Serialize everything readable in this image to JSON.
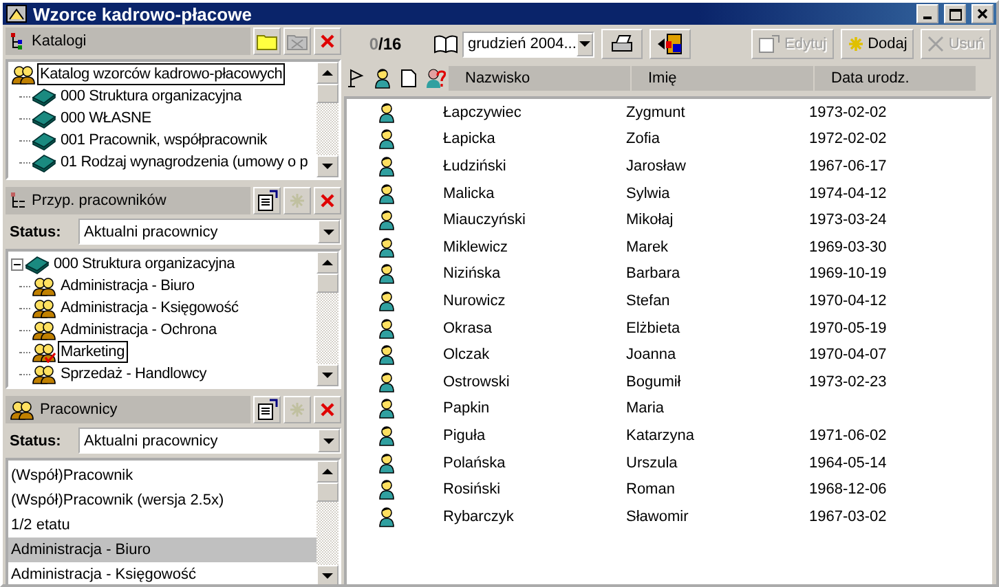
{
  "window": {
    "title": "Wzorce kadrowo-płacowe"
  },
  "katalogi": {
    "title": "Katalogi",
    "tree": [
      {
        "label": "Katalog wzorców kadrowo-płacowych",
        "kind": "group",
        "selected": true,
        "children": [
          {
            "label": "000 Struktura organizacyjna",
            "kind": "book",
            "selected": false
          },
          {
            "label": "000 WŁASNE",
            "kind": "book",
            "selected": false
          },
          {
            "label": "001 Pracownik, współpracownik",
            "kind": "book",
            "selected": false
          },
          {
            "label": "01 Rodzaj wynagrodzenia (umowy o p",
            "kind": "book",
            "selected": false
          }
        ]
      }
    ]
  },
  "przypisania": {
    "title": "Przyp. pracowników",
    "status_label": "Status:",
    "status_value": "Aktualni pracownicy",
    "tree": [
      {
        "label": "000 Struktura organizacyjna",
        "kind": "book",
        "selected": false,
        "expanded": true,
        "children": [
          {
            "label": "Administracja - Biuro",
            "kind": "group",
            "selected": false,
            "checked": false
          },
          {
            "label": "Administracja - Księgowość",
            "kind": "group",
            "selected": false,
            "checked": false
          },
          {
            "label": "Administracja - Ochrona",
            "kind": "group",
            "selected": false,
            "checked": false
          },
          {
            "label": "Marketing",
            "kind": "group",
            "selected": true,
            "checked": true
          },
          {
            "label": "Sprzedaż - Handlowcy",
            "kind": "group",
            "selected": false,
            "checked": false
          }
        ]
      }
    ]
  },
  "pracownicy": {
    "title": "Pracownicy",
    "status_label": "Status:",
    "status_value": "Aktualni pracownicy",
    "items": [
      {
        "label": "(Współ)Pracownik",
        "selected": false
      },
      {
        "label": "(Współ)Pracownik (wersja 2.5x)",
        "selected": false
      },
      {
        "label": "1/2 etatu",
        "selected": false
      },
      {
        "label": "Administracja - Biuro",
        "selected": true
      },
      {
        "label": "Administracja - Księgowość",
        "selected": false
      }
    ]
  },
  "toolbar": {
    "count_selected": "0",
    "count_total": "/16",
    "period": "grudzień 2004...",
    "buttons": [
      {
        "label": "Edytuj",
        "kind": "edit",
        "disabled": true
      },
      {
        "label": "Dodaj",
        "kind": "add",
        "disabled": false
      },
      {
        "label": "Usuń",
        "kind": "delete",
        "disabled": true
      }
    ]
  },
  "table": {
    "columns": [
      "Nazwisko",
      "Imię",
      "Data urodz."
    ],
    "rows": [
      [
        "Łapczywiec",
        "Zygmunt",
        "1973-02-02"
      ],
      [
        "Łapicka",
        "Zofia",
        "1972-02-02"
      ],
      [
        "Łudziński",
        "Jarosław",
        "1967-06-17"
      ],
      [
        "Malicka",
        "Sylwia",
        "1974-04-12"
      ],
      [
        "Miauczyński",
        "Mikołaj",
        "1973-03-24"
      ],
      [
        "Miklewicz",
        "Marek",
        "1969-03-30"
      ],
      [
        "Nizińska",
        "Barbara",
        "1969-10-19"
      ],
      [
        "Nurowicz",
        "Stefan",
        "1970-04-12"
      ],
      [
        "Okrasa",
        "Elżbieta",
        "1970-05-19"
      ],
      [
        "Olczak",
        "Joanna",
        "1970-04-07"
      ],
      [
        "Ostrowski",
        "Bogumił",
        "1973-02-23"
      ],
      [
        "Papkin",
        "Maria",
        ""
      ],
      [
        "Piguła",
        "Katarzyna",
        "1971-06-02"
      ],
      [
        "Polańska",
        "Urszula",
        "1964-05-14"
      ],
      [
        "Rosiński",
        "Roman",
        "1968-12-06"
      ],
      [
        "Rybarczyk",
        "Sławomir",
        "1967-03-02"
      ]
    ]
  }
}
